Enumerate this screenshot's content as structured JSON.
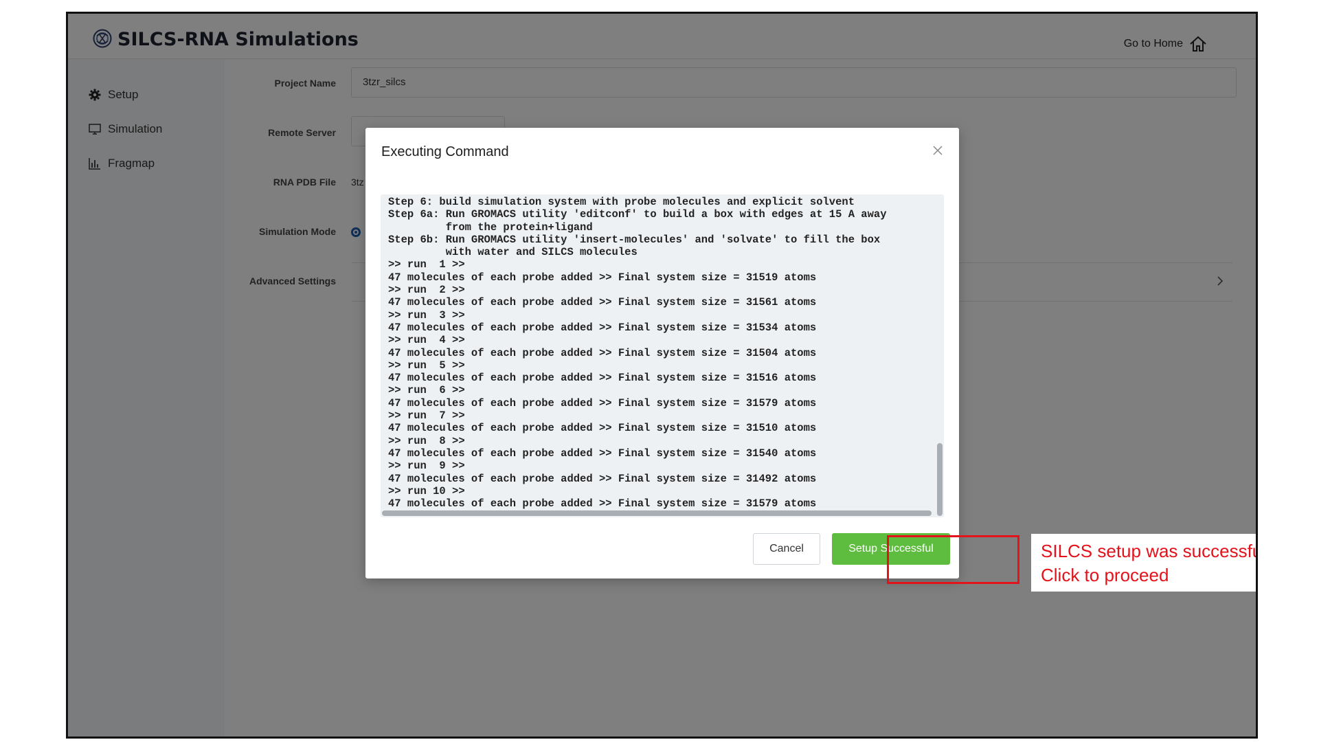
{
  "header": {
    "app_title": "SILCS-RNA Simulations",
    "home_link": "Go to Home"
  },
  "sidebar": {
    "items": [
      {
        "label": "Setup",
        "icon": "gear-icon"
      },
      {
        "label": "Simulation",
        "icon": "monitor-icon"
      },
      {
        "label": "Fragmap",
        "icon": "bar-chart-icon"
      }
    ]
  },
  "form": {
    "project_name_label": "Project Name",
    "project_name_value": "3tzr_silcs",
    "remote_server_label": "Remote Server",
    "rna_pdb_label": "RNA PDB File",
    "rna_pdb_value": "3tz",
    "simulation_mode_label": "Simulation Mode",
    "advanced_settings_label": "Advanced Settings"
  },
  "modal": {
    "title": "Executing Command",
    "console_lines": [
      "Step 6: build simulation system with probe molecules and explicit solvent",
      "Step 6a: Run GROMACS utility 'editconf' to build a box with edges at 15 A away",
      "         from the protein+ligand",
      "Step 6b: Run GROMACS utility 'insert-molecules' and 'solvate' to fill the box",
      "         with water and SILCS molecules",
      ">> run  1 >>",
      "47 molecules of each probe added >> Final system size = 31519 atoms",
      ">> run  2 >>",
      "47 molecules of each probe added >> Final system size = 31561 atoms",
      ">> run  3 >>",
      "47 molecules of each probe added >> Final system size = 31534 atoms",
      ">> run  4 >>",
      "47 molecules of each probe added >> Final system size = 31504 atoms",
      ">> run  5 >>",
      "47 molecules of each probe added >> Final system size = 31516 atoms",
      ">> run  6 >>",
      "47 molecules of each probe added >> Final system size = 31579 atoms",
      ">> run  7 >>",
      "47 molecules of each probe added >> Final system size = 31510 atoms",
      ">> run  8 >>",
      "47 molecules of each probe added >> Final system size = 31540 atoms",
      ">> run  9 >>",
      "47 molecules of each probe added >> Final system size = 31492 atoms",
      ">> run 10 >>",
      "47 molecules of each probe added >> Final system size = 31579 atoms"
    ],
    "cancel_label": "Cancel",
    "success_label": "Setup Successful"
  },
  "annotation": {
    "callout_text": "SILCS setup was successful;\nClick to proceed",
    "color": "#e3121b"
  },
  "colors": {
    "success_green": "#5ebd3e",
    "radio_blue": "#1f5fb0"
  }
}
